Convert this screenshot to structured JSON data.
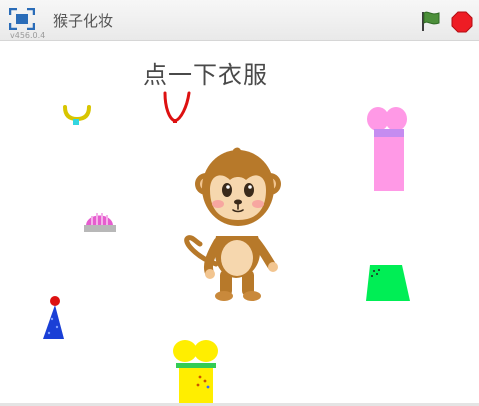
{
  "window": {
    "title": "猴子化妆",
    "version": "v456.0.4"
  },
  "toolbar": {
    "fullscreen_icon": "fullscreen-icon",
    "green_flag_icon": "green-flag-icon",
    "stop_icon": "stop-sign-icon",
    "colors": {
      "flag": "#4c8f3a",
      "stop": "#ee1c24",
      "fullscreen": "#2a6cb8"
    }
  },
  "stage": {
    "instruction": "点一下衣服",
    "sprites": [
      {
        "name": "yellow-necklace",
        "color": "#d8c500"
      },
      {
        "name": "red-necklace",
        "color": "#dd1111"
      },
      {
        "name": "pink-dress",
        "color": "#ff99e6"
      },
      {
        "name": "striped-cap",
        "color": "#e65ccf"
      },
      {
        "name": "monkey",
        "color": "#c0842a"
      },
      {
        "name": "party-hat",
        "color": "#1a3fd6"
      },
      {
        "name": "green-skirt",
        "color": "#00ee55"
      },
      {
        "name": "yellow-dress",
        "color": "#ffee00"
      }
    ]
  }
}
